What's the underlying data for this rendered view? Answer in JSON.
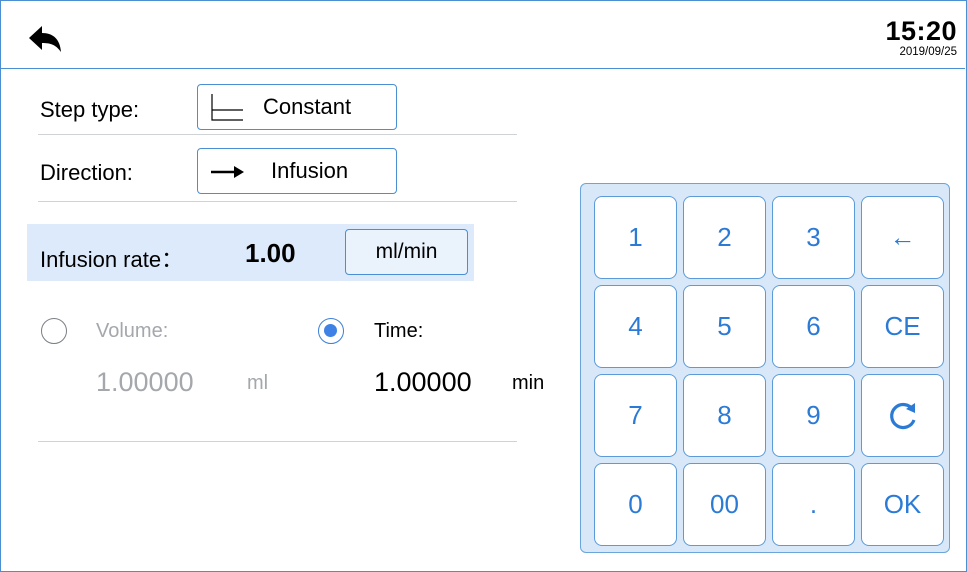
{
  "header": {
    "back_icon": "back-arrow-icon",
    "time": "15:20",
    "date": "2019/09/25"
  },
  "step_type": {
    "label": "Step type:",
    "value": "Constant",
    "icon": "constant-step-icon"
  },
  "direction": {
    "label": "Direction:",
    "value": "Infusion",
    "icon": "right-arrow-icon"
  },
  "infusion_rate": {
    "label": "Infusion rate：",
    "value": "1.00",
    "unit": "ml/min"
  },
  "volume": {
    "label": "Volume:",
    "value": "1.00000",
    "unit": "ml",
    "selected": false
  },
  "time_setting": {
    "label": "Time:",
    "value": "1.00000",
    "unit": "min",
    "selected": true
  },
  "keypad": {
    "keys": [
      "1",
      "2",
      "3",
      "←",
      "4",
      "5",
      "6",
      "CE",
      "7",
      "8",
      "9",
      "",
      "0",
      "00",
      ".",
      "OK"
    ],
    "refresh_icon": "refresh-icon"
  },
  "colors": {
    "accent": "#4a8fd1",
    "key_text": "#2b7bd6",
    "rate_band": "#ddeafb",
    "disabled_text": "#a4a8ac"
  }
}
